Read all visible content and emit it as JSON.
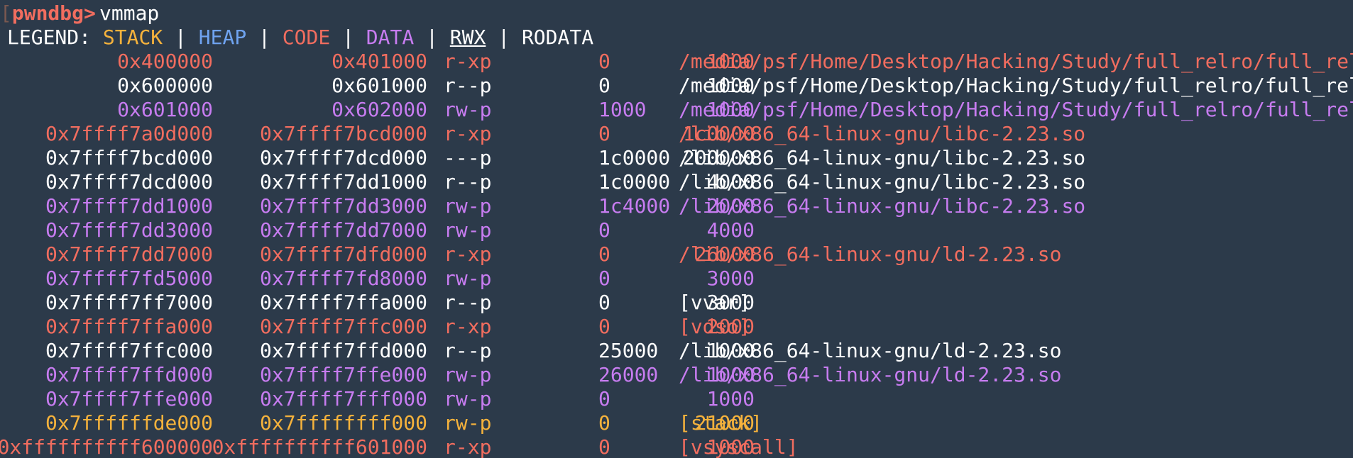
{
  "colors": {
    "background": "#2c3a4a",
    "stack": "#f5b23c",
    "heap": "#6fa3f0",
    "code": "#f16d5f",
    "data": "#c77cf0",
    "rodata": "#ffffff",
    "text": "#ffffff"
  },
  "prompt": {
    "label": "pwndbg>",
    "command": "vmmap"
  },
  "legend": {
    "label": "LEGEND:",
    "sep": "|",
    "stack": "STACK",
    "heap": "HEAP",
    "code": "CODE",
    "data": "DATA",
    "rwx": "RWX",
    "rodata": "RODATA"
  },
  "mappings": [
    {
      "start": "0x400000",
      "end": "0x401000",
      "perm": "r-xp",
      "size": "1000",
      "offset": "0",
      "path": "/media/psf/Home/Desktop/Hacking/Study/full_relro/full_relro",
      "kind": "code"
    },
    {
      "start": "0x600000",
      "end": "0x601000",
      "perm": "r--p",
      "size": "1000",
      "offset": "0",
      "path": "/media/psf/Home/Desktop/Hacking/Study/full_relro/full_relro",
      "kind": "rodata"
    },
    {
      "start": "0x601000",
      "end": "0x602000",
      "perm": "rw-p",
      "size": "1000",
      "offset": "1000",
      "path": "/media/psf/Home/Desktop/Hacking/Study/full_relro/full_relro",
      "kind": "data"
    },
    {
      "start": "0x7ffff7a0d000",
      "end": "0x7ffff7bcd000",
      "perm": "r-xp",
      "size": "1c0000",
      "offset": "0",
      "path": "/lib/x86_64-linux-gnu/libc-2.23.so",
      "kind": "code"
    },
    {
      "start": "0x7ffff7bcd000",
      "end": "0x7ffff7dcd000",
      "perm": "---p",
      "size": "200000",
      "offset": "1c0000",
      "path": "/lib/x86_64-linux-gnu/libc-2.23.so",
      "kind": "rodata"
    },
    {
      "start": "0x7ffff7dcd000",
      "end": "0x7ffff7dd1000",
      "perm": "r--p",
      "size": "4000",
      "offset": "1c0000",
      "path": "/lib/x86_64-linux-gnu/libc-2.23.so",
      "kind": "rodata"
    },
    {
      "start": "0x7ffff7dd1000",
      "end": "0x7ffff7dd3000",
      "perm": "rw-p",
      "size": "2000",
      "offset": "1c4000",
      "path": "/lib/x86_64-linux-gnu/libc-2.23.so",
      "kind": "data"
    },
    {
      "start": "0x7ffff7dd3000",
      "end": "0x7ffff7dd7000",
      "perm": "rw-p",
      "size": "4000",
      "offset": "0",
      "path": "",
      "kind": "data"
    },
    {
      "start": "0x7ffff7dd7000",
      "end": "0x7ffff7dfd000",
      "perm": "r-xp",
      "size": "26000",
      "offset": "0",
      "path": "/lib/x86_64-linux-gnu/ld-2.23.so",
      "kind": "code"
    },
    {
      "start": "0x7ffff7fd5000",
      "end": "0x7ffff7fd8000",
      "perm": "rw-p",
      "size": "3000",
      "offset": "0",
      "path": "",
      "kind": "data"
    },
    {
      "start": "0x7ffff7ff7000",
      "end": "0x7ffff7ffa000",
      "perm": "r--p",
      "size": "3000",
      "offset": "0",
      "path": "[vvar]",
      "kind": "rodata"
    },
    {
      "start": "0x7ffff7ffa000",
      "end": "0x7ffff7ffc000",
      "perm": "r-xp",
      "size": "2000",
      "offset": "0",
      "path": "[vdso]",
      "kind": "code"
    },
    {
      "start": "0x7ffff7ffc000",
      "end": "0x7ffff7ffd000",
      "perm": "r--p",
      "size": "1000",
      "offset": "25000",
      "path": "/lib/x86_64-linux-gnu/ld-2.23.so",
      "kind": "rodata"
    },
    {
      "start": "0x7ffff7ffd000",
      "end": "0x7ffff7ffe000",
      "perm": "rw-p",
      "size": "1000",
      "offset": "26000",
      "path": "/lib/x86_64-linux-gnu/ld-2.23.so",
      "kind": "data"
    },
    {
      "start": "0x7ffff7ffe000",
      "end": "0x7ffff7fff000",
      "perm": "rw-p",
      "size": "1000",
      "offset": "0",
      "path": "",
      "kind": "data"
    },
    {
      "start": "0x7ffffffde000",
      "end": "0x7ffffffff000",
      "perm": "rw-p",
      "size": "21000",
      "offset": "0",
      "path": "[stack]",
      "kind": "stack"
    },
    {
      "start": "0xffffffffff600000",
      "end": "0xffffffffff601000",
      "perm": "r-xp",
      "size": "1000",
      "offset": "0",
      "path": "[vsyscall]",
      "kind": "code"
    }
  ]
}
